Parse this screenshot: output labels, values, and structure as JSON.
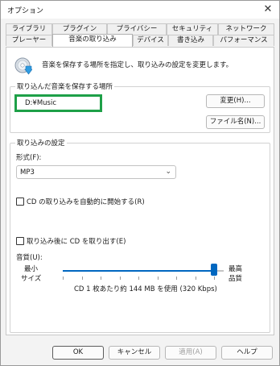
{
  "window": {
    "title": "オプション"
  },
  "tabs_row1": [
    "ライブラリ",
    "プラグイン",
    "プライバシー",
    "セキュリティ",
    "ネットワーク"
  ],
  "tabs_row2": [
    "プレーヤー",
    "音楽の取り込み",
    "デバイス",
    "書き込み",
    "パフォーマンス"
  ],
  "active_tab": "音楽の取り込み",
  "header": {
    "icon": "cd-rip-icon",
    "description": "音楽を保存する場所を指定し、取り込みの設定を変更します。"
  },
  "location_group": {
    "label": "取り込んだ音楽を保存する場所",
    "path": "D:¥Music",
    "change_button": "変更(H)...",
    "filename_button": "ファイル名(N)..."
  },
  "settings_group": {
    "label": "取り込みの設定",
    "format_label": "形式(F):",
    "format_value": "MP3",
    "auto_rip_label": "CD の取り込みを自動的に開始する(R)",
    "auto_rip_checked": false,
    "eject_label": "取り込み後に CD を取り出す(E)",
    "eject_checked": false,
    "quality_label": "音質(U):",
    "min_label_1": "最小",
    "min_label_2": "サイズ",
    "max_label_1": "最高",
    "max_label_2": "品質",
    "quality_level": 1.0,
    "usage_text": "CD 1 枚あたり約 144 MB を使用 (320 Kbps)"
  },
  "buttons": {
    "ok": "OK",
    "cancel": "キャンセル",
    "apply": "適用(A)",
    "help": "ヘルプ"
  },
  "colors": {
    "accent": "#0067c0",
    "highlight": "#1ea048"
  }
}
